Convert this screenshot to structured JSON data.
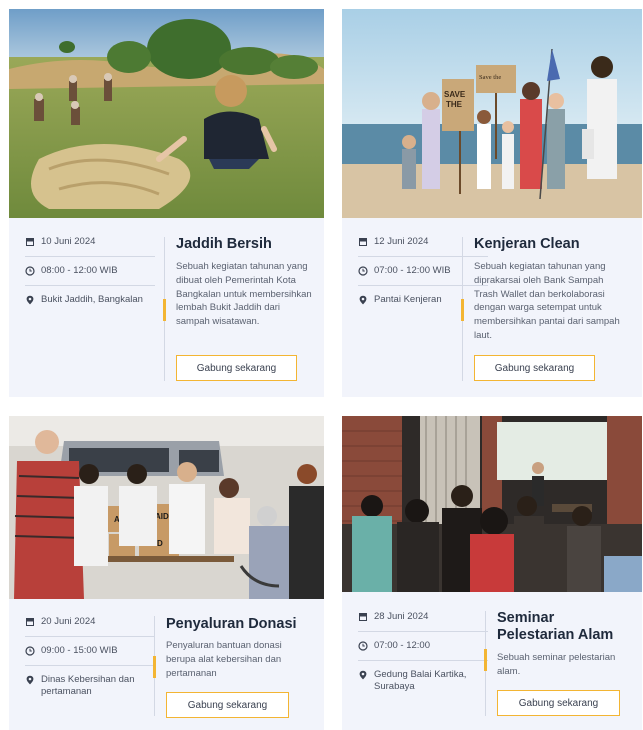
{
  "events": [
    {
      "date": "10 Juni 2024",
      "time": "08:00 - 12:00 WIB",
      "location": "Bukit Jaddih, Bangkalan",
      "title": "Jaddih Bersih",
      "description": "Sebuah kegiatan tahunan yang dibuat oleh Pemerintah Kota Bangkalan untuk membersihkan lembah Bukit Jaddih dari sampah wisatawan.",
      "button": "Gabung sekarang"
    },
    {
      "date": "12 Juni 2024",
      "time": "07:00 - 12:00 WIB",
      "location": "Pantai Kenjeran",
      "title": "Kenjeran Clean",
      "description": "Sebuah kegiatan tahunan yang diprakarsai oleh Bank Sampah Trash Wallet dan berkolaborasi dengan warga setempat untuk membersihkan pantai dari sampah laut.",
      "button": "Gabung sekarang",
      "signs": [
        "SAVE THE EARTH",
        "Save the Earth"
      ]
    },
    {
      "date": "20 Juni 2024",
      "time": "09:00 - 15:00 WIB",
      "location": "Dinas Kebersihan dan pertamanan",
      "title": "Penyaluran Donasi",
      "description": "Penyaluran bantuan donasi berupa alat kebersihan dan pertamanan",
      "button": "Gabung sekarang",
      "boxes": [
        "AID",
        "AID",
        "AID"
      ]
    },
    {
      "date": "28 Juni 2024",
      "time": "07:00 - 12:00",
      "location": "Gedung Balai Kartika, Surabaya",
      "title": "Seminar Pelestarian Alam",
      "description": "Sebuah seminar pelestarian alam.",
      "button": "Gabung sekarang"
    }
  ],
  "colors": {
    "accent": "#f3b533",
    "card_bg": "#f2f4fb",
    "title": "#1f2a3c"
  },
  "icons": {
    "date": "calendar-icon",
    "time": "clock-icon",
    "location": "map-pin-icon"
  }
}
